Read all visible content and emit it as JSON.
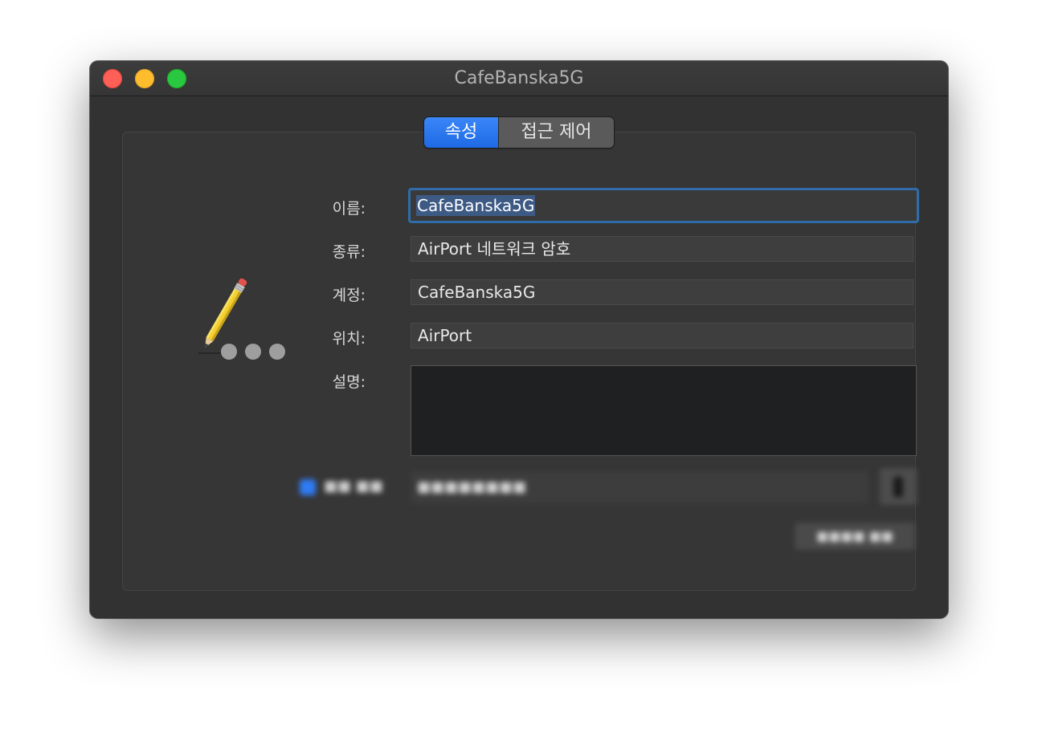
{
  "window": {
    "title": "CafeBanska5G"
  },
  "tabs": [
    {
      "label": "속성",
      "selected": true
    },
    {
      "label": "접근 제어",
      "selected": false
    }
  ],
  "icon": "pencil-with-dots-icon",
  "fields": {
    "name": {
      "label": "이름:",
      "value": "CafeBanska5G"
    },
    "kind": {
      "label": "종류:",
      "value": "AirPort 네트워크 암호"
    },
    "account": {
      "label": "계정:",
      "value": "CafeBanska5G"
    },
    "where": {
      "label": "위치:",
      "value": "AirPort"
    },
    "comments": {
      "label": "설명:",
      "value": ""
    }
  },
  "colors": {
    "accent": "#1d6ae5",
    "focus_ring": "#2f6ca8",
    "window_bg": "#323232"
  }
}
